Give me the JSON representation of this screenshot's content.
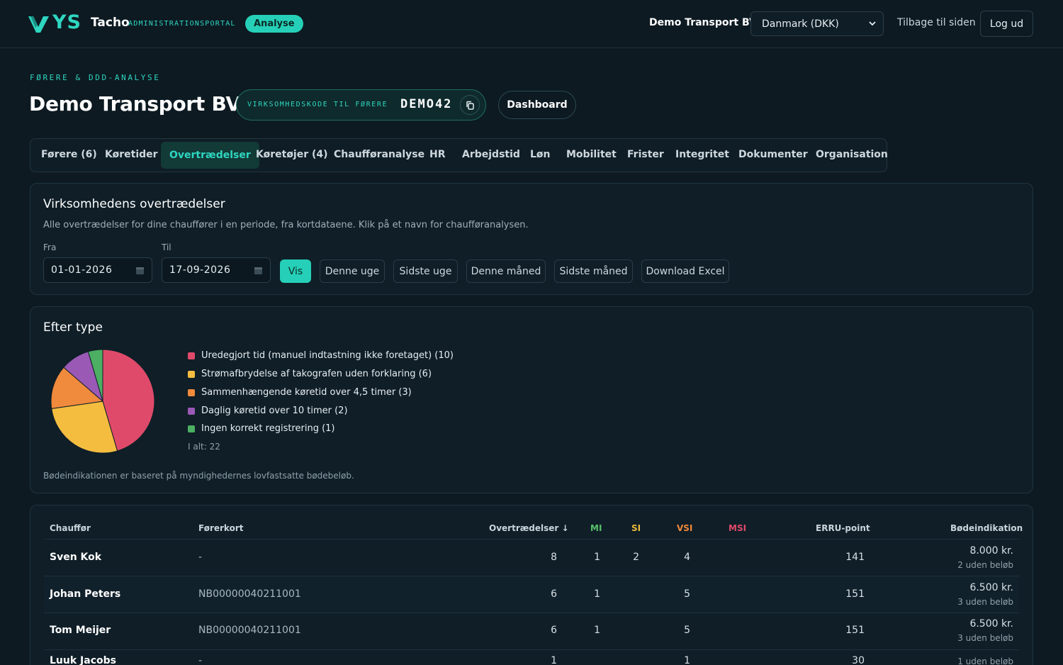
{
  "header": {
    "brand_mark": "YS",
    "brand_name": "Tacho",
    "brand_sub": "ADMINISTRATIONSPORTAL",
    "badge": "Analyse",
    "company": "Demo Transport BV",
    "country_selected": "Danmark (DKK)",
    "back_link": "Tilbage til siden",
    "logout": "Log ud"
  },
  "page": {
    "eyebrow": "FØRERE & DDD-ANALYSE",
    "title": "Demo Transport BV",
    "code_label": "VIRKSOMHEDSKODE TIL FØRERE",
    "code_value": "DEMO42",
    "dashboard": "Dashboard"
  },
  "tabs": [
    {
      "label": "Førere (6)"
    },
    {
      "label": "Køretider"
    },
    {
      "label": "Overtrædelser",
      "active": true
    },
    {
      "label": "Køretøjer (4)"
    },
    {
      "label": "Chaufføranalyse"
    },
    {
      "label": "HR"
    },
    {
      "label": "Arbejdstid"
    },
    {
      "label": "Løn"
    },
    {
      "label": "Mobilitet"
    },
    {
      "label": "Frister"
    },
    {
      "label": "Integritet"
    },
    {
      "label": "Dokumenter"
    },
    {
      "label": "Organisation"
    }
  ],
  "filter": {
    "title": "Virksomhedens overtrædelser",
    "description": "Alle overtrædelser for dine chauffører i en periode, fra kortdataene. Klik på et navn for chaufføranalysen.",
    "from_label": "Fra",
    "from_value": "01-01-2026",
    "to_label": "Til",
    "to_value": "17-09-2026",
    "vis": "Vis",
    "this_week": "Denne uge",
    "last_week": "Sidste uge",
    "this_month": "Denne måned",
    "last_month": "Sidste måned",
    "download": "Download Excel"
  },
  "by_type": {
    "title": "Efter type",
    "total": "I alt: 22",
    "footnote": "Bødeindikationen er baseret på myndighedernes lovfastsatte bødebeløb.",
    "legend": [
      {
        "label": "Uredegjort tid (manuel indtastning ikke foretaget) (10)",
        "color": "#e04a6a",
        "value": 10
      },
      {
        "label": "Strømafbrydelse af takografen uden forklaring (6)",
        "color": "#f4bd3f",
        "value": 6
      },
      {
        "label": "Sammenhængende køretid over 4,5 timer (3)",
        "color": "#f08a3c",
        "value": 3
      },
      {
        "label": "Daglig køretid over 10 timer (2)",
        "color": "#9b59b6",
        "value": 2
      },
      {
        "label": "Ingen korrekt registrering (1)",
        "color": "#4caf63",
        "value": 1
      }
    ]
  },
  "table": {
    "headers": {
      "driver": "Chauffør",
      "license": "Førerkort",
      "violations": "Overtrædelser ↓",
      "mi": "MI",
      "si": "SI",
      "vsi": "VSI",
      "msi": "MSI",
      "erru": "ERRU-point",
      "fine": "Bødeindikation"
    },
    "rows": [
      {
        "driver": "Sven Kok",
        "license": "-",
        "violations": "8",
        "mi": "1",
        "si": "2",
        "vsi": "4",
        "msi": "",
        "erru": "141",
        "fine": "8.000 kr.",
        "fine_note": "2 uden beløb"
      },
      {
        "driver": "Johan Peters",
        "license": "NB00000040211001",
        "violations": "6",
        "mi": "1",
        "si": "",
        "vsi": "5",
        "msi": "",
        "erru": "151",
        "fine": "6.500 kr.",
        "fine_note": "3 uden beløb"
      },
      {
        "driver": "Tom Meijer",
        "license": "NB00000040211001",
        "violations": "6",
        "mi": "1",
        "si": "",
        "vsi": "5",
        "msi": "",
        "erru": "151",
        "fine": "6.500 kr.",
        "fine_note": "3 uden beløb"
      },
      {
        "driver": "Luuk Jacobs",
        "license": "-",
        "violations": "1",
        "mi": "",
        "si": "",
        "vsi": "1",
        "msi": "",
        "erru": "30",
        "fine": "",
        "fine_note": "1 uden beløb"
      }
    ]
  }
}
